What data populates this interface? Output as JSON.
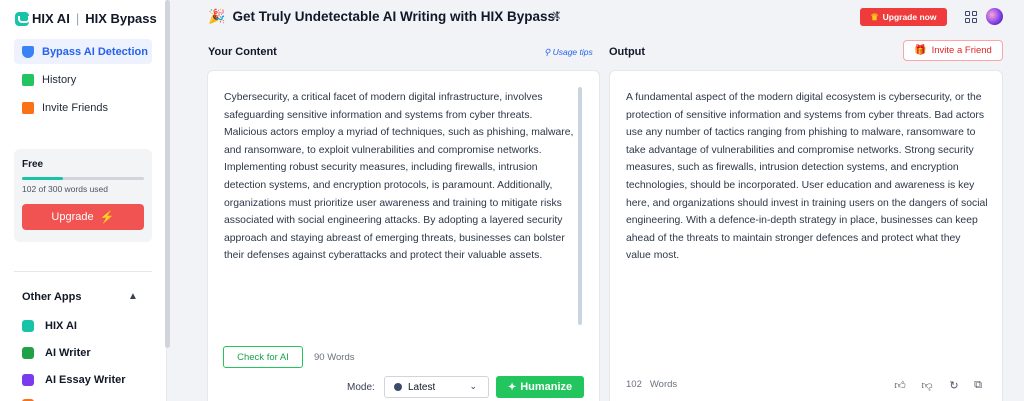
{
  "brand": {
    "name": "HIX AI",
    "product": "HIX Bypass"
  },
  "nav": [
    {
      "label": "Bypass AI Detection",
      "icon": "shield-icon",
      "active": true
    },
    {
      "label": "History",
      "icon": "document-icon",
      "active": false
    },
    {
      "label": "Invite Friends",
      "icon": "gift-icon",
      "active": false
    }
  ],
  "plan": {
    "name": "Free",
    "usage_text": "102 of 300 words used",
    "used_fraction": 0.34,
    "upgrade_label": "Upgrade"
  },
  "other_apps": {
    "title": "Other Apps",
    "items": [
      {
        "label": "HIX AI",
        "icon": "hix-ai-icon"
      },
      {
        "label": "AI Writer",
        "icon": "ai-writer-icon"
      },
      {
        "label": "AI Essay Writer",
        "icon": "ai-essay-writer-icon"
      }
    ]
  },
  "header": {
    "promo_text": "Get Truly Undetectable AI Writing with HIX Bypass!",
    "upgrade_now_label": "Upgrade now"
  },
  "input": {
    "title": "Your Content",
    "usage_tips": "Usage tips",
    "text": "Cybersecurity, a critical facet of modern digital infrastructure, involves safeguarding sensitive information and systems from cyber threats. Malicious actors employ a myriad of techniques, such as phishing, malware, and ransomware, to exploit vulnerabilities and compromise networks. Implementing robust security measures, including firewalls, intrusion detection systems, and encryption protocols, is paramount. Additionally, organizations must prioritize user awareness and training to mitigate risks associated with social engineering attacks. By adopting a layered security approach and staying abreast of emerging threats, businesses can bolster their defenses against cyberattacks and protect their valuable assets.",
    "check_label": "Check for AI",
    "word_count": "90 Words",
    "mode_label": "Mode:",
    "mode_value": "Latest",
    "humanize_label": "Humanize"
  },
  "output": {
    "title": "Output",
    "invite_label": "Invite a Friend",
    "text": "A fundamental aspect of the modern digital ecosystem is cybersecurity, or the protection of sensitive information and systems from cyber threats. Bad actors use any number of tactics ranging from phishing to malware, ransomware to take advantage of vulnerabilities and compromise networks. Strong security measures, such as firewalls, intrusion detection systems, and encryption technologies, should be incorporated. User education and awareness is key here, and organizations should invest in training users on the dangers of social engineering. With a defence-in-depth strategy in place, businesses can keep ahead of the threats to maintain stronger defences and protect what they value most.",
    "word_count_number": "102",
    "word_count_label": "Words"
  },
  "colors": {
    "accent": "#22c55e",
    "brand": "#19c3a8",
    "danger": "#ef3b3b",
    "link": "#2563eb"
  }
}
